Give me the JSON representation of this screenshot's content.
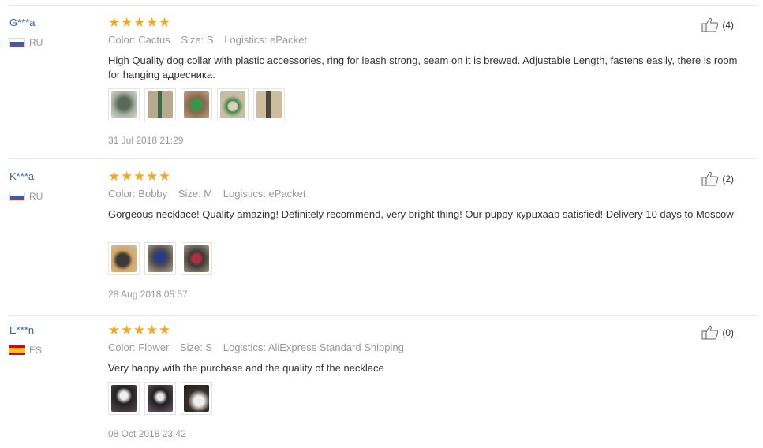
{
  "reviews": [
    {
      "buyer": "G***a",
      "country": "RU",
      "flag": "flag-ru",
      "rating": 5,
      "color": "Color: Cactus",
      "size": "Size: S",
      "logistics": "Logistics: ePacket",
      "text": "High Quality dog collar with plastic accessories, ring for leash strong, seam on it is brewed. Adjustable Length, fastens easily, there is room for hanging адресника.",
      "photos": 5,
      "date": "31 Jul 2018 21:29",
      "helpful": "(4)"
    },
    {
      "buyer": "K***a",
      "country": "RU",
      "flag": "flag-ru",
      "rating": 5,
      "color": "Color: Bobby",
      "size": "Size: M",
      "logistics": "Logistics: ePacket",
      "text": "Gorgeous necklace! Quality amazing! Definitely recommend, very bright thing! Our puppy-курцхаар satisfied! Delivery 10 days to Moscow",
      "photos": 3,
      "date": "28 Aug 2018 05:57",
      "helpful": "(2)"
    },
    {
      "buyer": "E***n",
      "country": "ES",
      "flag": "flag-es",
      "rating": 5,
      "color": "Color: Flower",
      "size": "Size: S",
      "logistics": "Logistics: AliExpress Standard Shipping",
      "text": "Very happy with the purchase and the quality of the necklace",
      "photos": 3,
      "date": "08 Oct 2018 23:42",
      "helpful": "(0)"
    }
  ],
  "colors": {
    "star": "#f5a623",
    "buyer_link": "#3366aa",
    "muted": "#999999",
    "body_text": "#333333"
  },
  "icons": {
    "rating": "star-icon",
    "helpful": "thumbs-up-icon"
  }
}
